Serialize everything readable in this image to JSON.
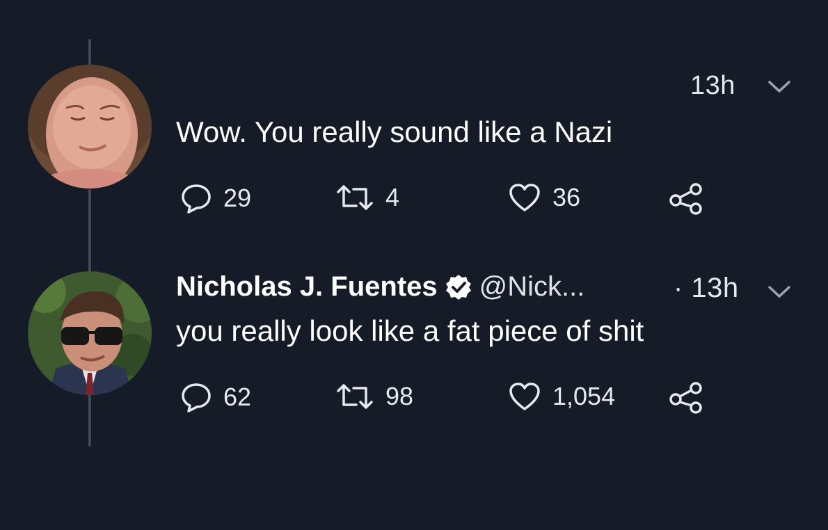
{
  "tweets": [
    {
      "time": "13h",
      "text": "Wow. You really sound like a Nazi",
      "avatar": "avatar-woman",
      "replies": "29",
      "retweets": "4",
      "likes": "36"
    },
    {
      "name": "Nicholas J. Fuentes",
      "handle": "@Nick...",
      "time": "· 13h",
      "text": "you really look like a fat piece of shit",
      "avatar": "avatar-man-sunglasses",
      "replies": "62",
      "retweets": "98",
      "likes": "1,054"
    }
  ],
  "colors": {
    "background": "#161c27",
    "thread_line": "#3d4a5a",
    "text": "#ffffff"
  },
  "icons": [
    "reply-icon",
    "retweet-icon",
    "like-icon",
    "share-icon",
    "chevron-down-icon",
    "verified-badge-icon"
  ]
}
